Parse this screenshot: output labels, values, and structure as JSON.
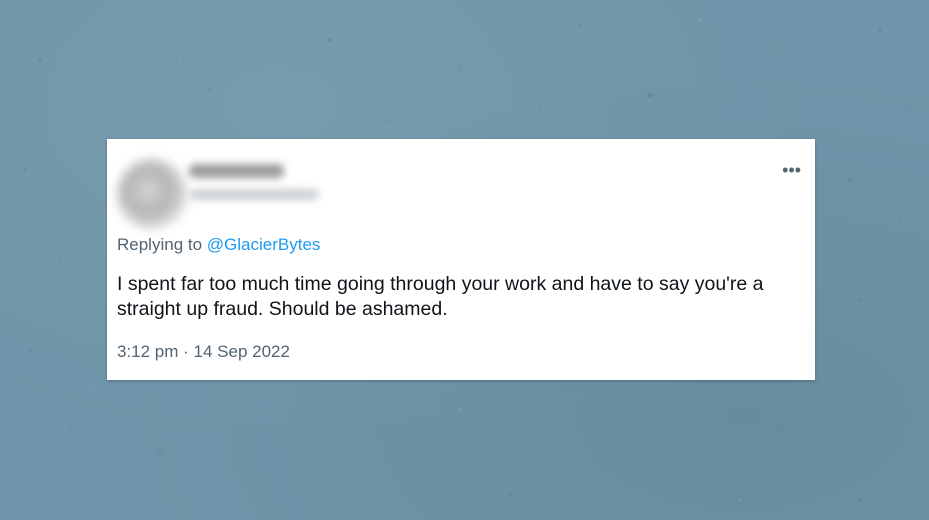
{
  "tweet": {
    "replying_prefix": "Replying to",
    "replying_to": "@GlacierBytes",
    "text": "I spent far too much time going through your work and have to say you're a straight up fraud. Should be ashamed.",
    "timestamp": "3:12 pm · 14 Sep 2022",
    "more_icon": "more-options-icon"
  },
  "colors": {
    "background": "#6e95a9",
    "card": "#ffffff",
    "link": "#1d9bf0",
    "secondary_text": "#536471",
    "primary_text": "#0f1419"
  }
}
